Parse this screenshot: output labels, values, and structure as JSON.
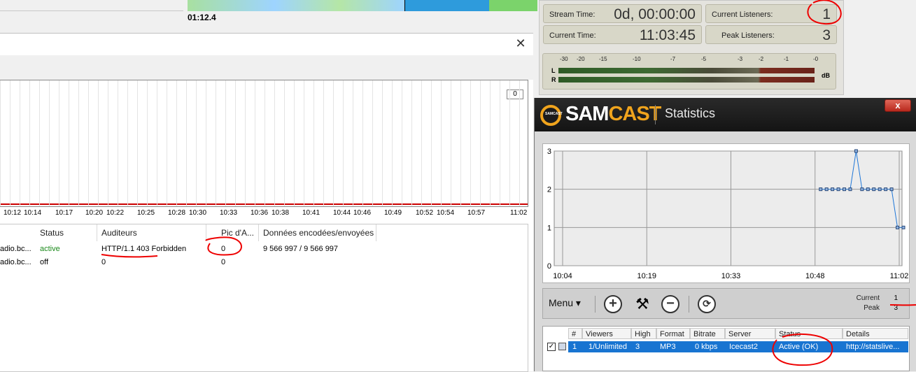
{
  "top": {
    "elapsed_time": "01:12.4"
  },
  "encoder_panel": {
    "stream_time_label": "Stream Time:",
    "stream_time_value": "0d, 00:00:00",
    "current_time_label": "Current Time:",
    "current_time_value": "11:03:45",
    "current_listeners_label": "Current Listeners:",
    "current_listeners_value": "1",
    "peak_listeners_label": "Peak Listeners:",
    "peak_listeners_value": "3",
    "vu_scale": [
      "-30",
      "-20",
      "-15",
      "-10",
      "-7",
      "-5",
      "-3",
      "-2",
      "-1",
      "-0"
    ],
    "vu_left": "L",
    "vu_right": "R",
    "vu_unit": "dB"
  },
  "left_window": {
    "graph_value": "0",
    "x_ticks": [
      "10:12",
      "10:14",
      "10:17",
      "10:20",
      "10:22",
      "10:25",
      "10:28",
      "10:30",
      "10:33",
      "10:36",
      "10:38",
      "10:41",
      "10:44",
      "10:46",
      "10:49",
      "10:52",
      "10:54",
      "10:57",
      "11:02"
    ],
    "columns": [
      "Status",
      "Auditeurs",
      "Pic d'A...",
      "Données encodées/envoyées"
    ],
    "rows": [
      {
        "name": "adio.bc...",
        "status": "active",
        "listeners": "HTTP/1.1 403 Forbidden",
        "peak": "0",
        "data": "9 566 997 / 9 566 997"
      },
      {
        "name": "adio.bc...",
        "status": "off",
        "listeners": "0",
        "peak": "0",
        "data": ""
      }
    ]
  },
  "samcast": {
    "logo_sam": "SAM",
    "logo_cast": "CAST",
    "logo_small": "SAMCAST",
    "title": "Statistics",
    "close_label": "x",
    "menu_label": "Menu ▾",
    "current_label": "Current",
    "peak_label": "Peak",
    "current_value": "1",
    "peak_value": "3",
    "table_columns": [
      "#",
      "Viewers",
      "High",
      "Format",
      "Bitrate",
      "Server",
      "Status",
      "Details"
    ],
    "table_row": {
      "num": "1",
      "viewers": "1/Unlimited",
      "high": "3",
      "format": "MP3",
      "bitrate": "0 kbps",
      "server": "Icecast2",
      "status": "Active (OK)",
      "details": "http://statslive..."
    }
  },
  "chart_data": {
    "type": "line",
    "x_ticks": [
      "10:04",
      "10:19",
      "10:33",
      "10:48",
      "11:02"
    ],
    "y_ticks": [
      "0",
      "1",
      "2",
      "3"
    ],
    "ylim": [
      0,
      3
    ],
    "series": [
      {
        "values": [
          2,
          2,
          2,
          2,
          2,
          2,
          3,
          2,
          2,
          2,
          2,
          2,
          2,
          1,
          1
        ]
      }
    ],
    "colors": {
      "line": "#1f77d8",
      "point": "#2a4a7a"
    }
  }
}
